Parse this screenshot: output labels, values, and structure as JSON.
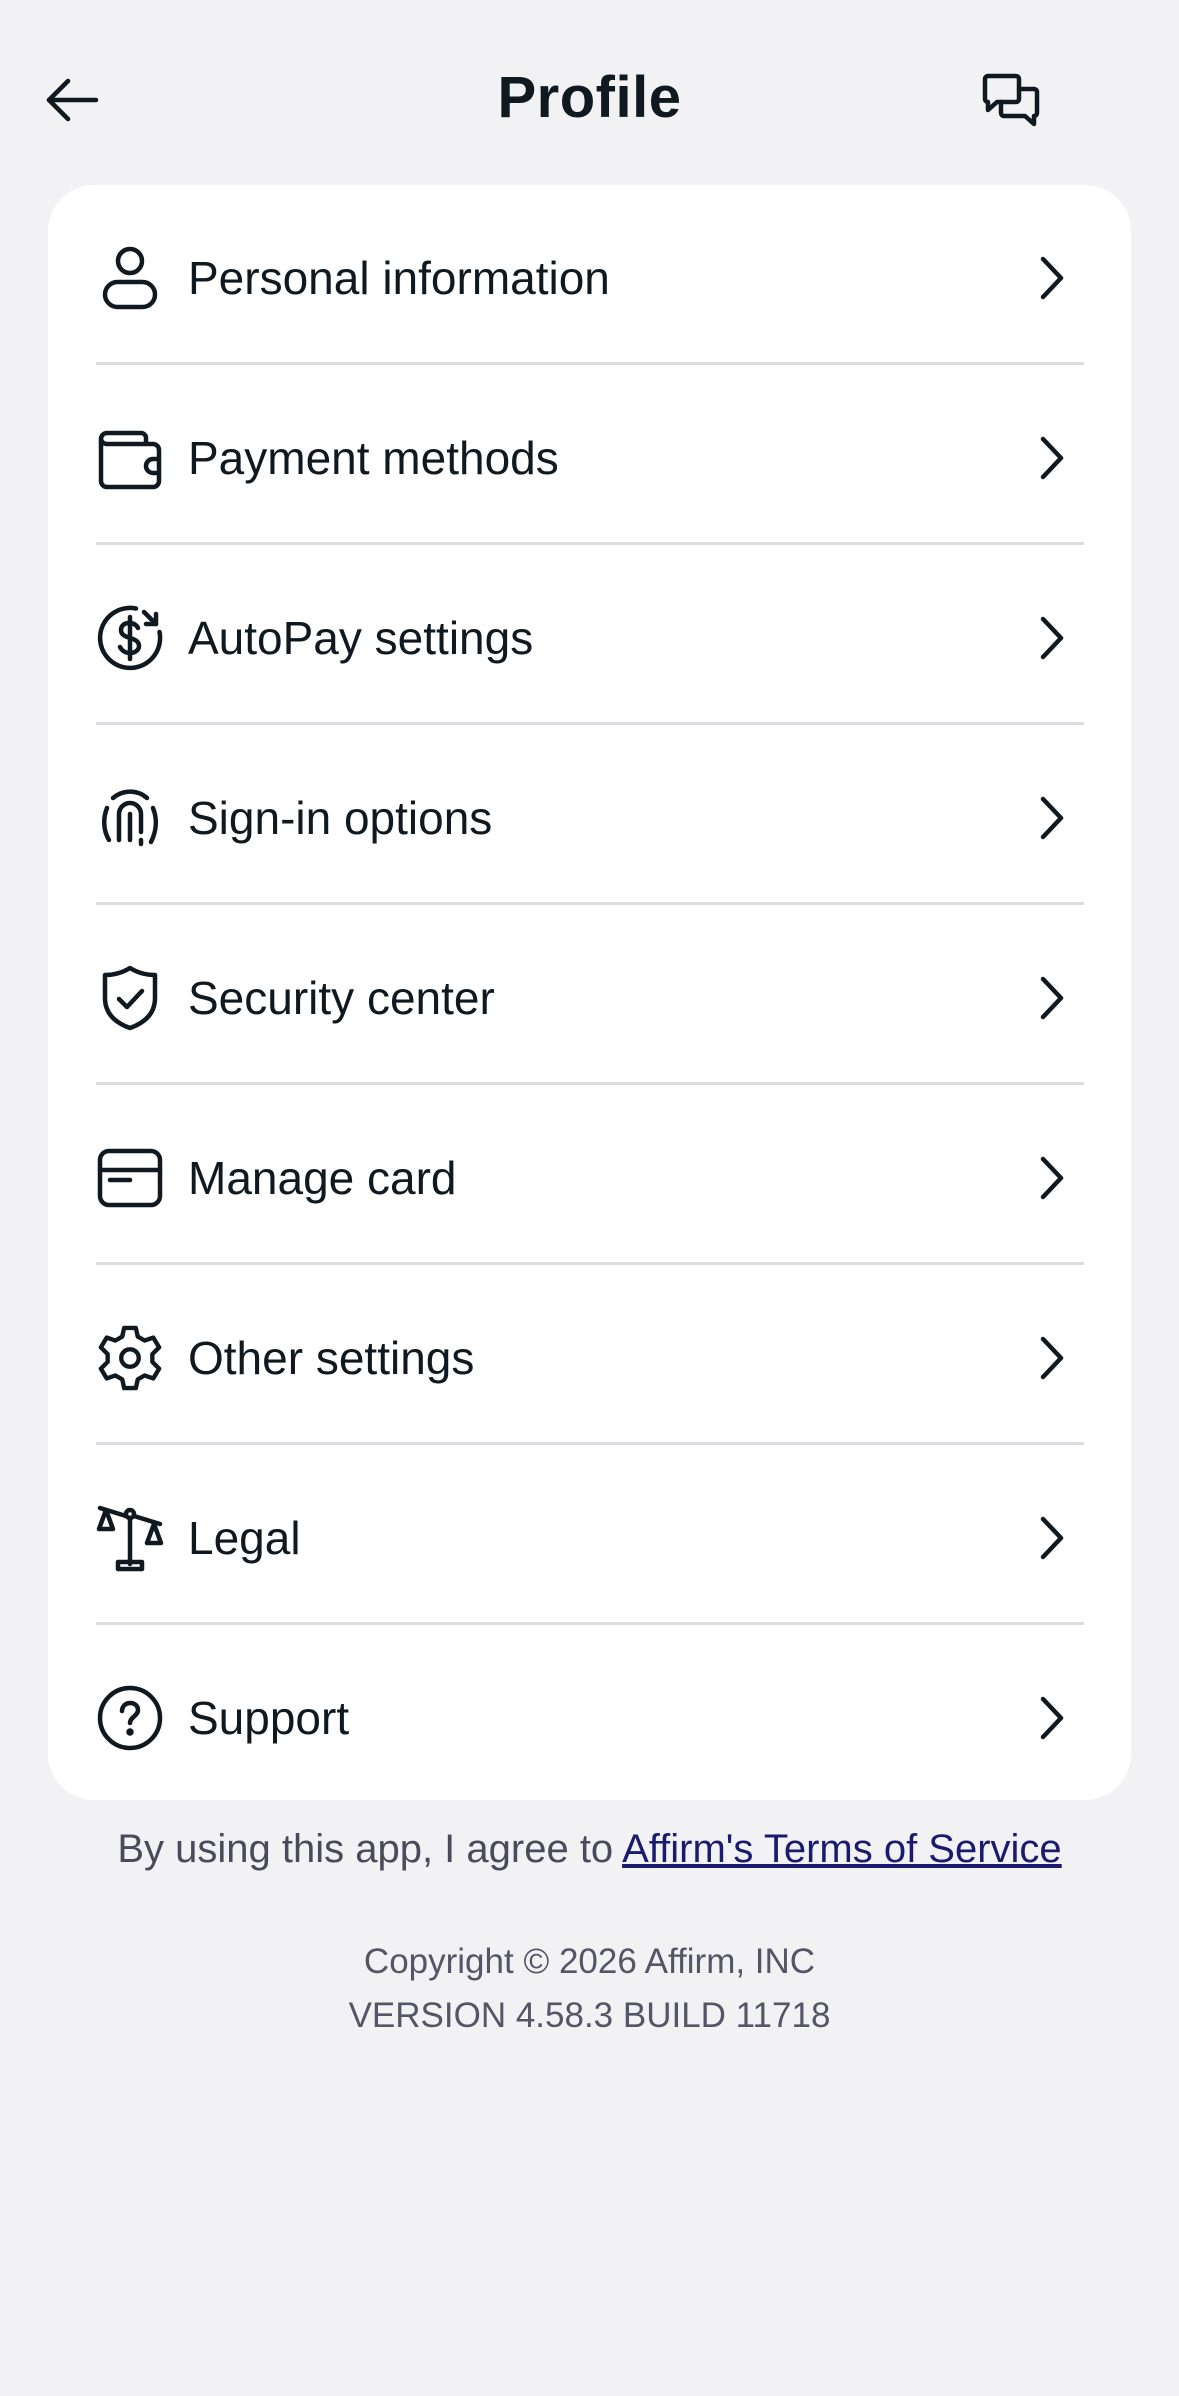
{
  "header": {
    "title": "Profile",
    "back_icon": "arrow-left-icon",
    "chat_icon": "chat-bubbles-icon"
  },
  "menu": {
    "items": [
      {
        "label": "Personal information",
        "icon": "person-icon"
      },
      {
        "label": "Payment methods",
        "icon": "wallet-icon"
      },
      {
        "label": "AutoPay settings",
        "icon": "autopay-dollar-icon"
      },
      {
        "label": "Sign-in options",
        "icon": "fingerprint-icon"
      },
      {
        "label": "Security center",
        "icon": "shield-check-icon"
      },
      {
        "label": "Manage card",
        "icon": "card-icon"
      },
      {
        "label": "Other settings",
        "icon": "gear-icon"
      },
      {
        "label": "Legal",
        "icon": "scales-icon"
      },
      {
        "label": "Support",
        "icon": "question-circle-icon"
      }
    ]
  },
  "terms": {
    "prefix": "By using this app, I agree to ",
    "link": "Affirm's Terms of Service"
  },
  "footer": {
    "copyright": "Copyright © 2026 Affirm, INC",
    "version": "VERSION 4.58.3 BUILD 11718"
  },
  "colors": {
    "background": "#f2f2f5",
    "card": "#ffffff",
    "text": "#101820",
    "link": "#1a1a6e",
    "divider": "#dcdce1"
  }
}
